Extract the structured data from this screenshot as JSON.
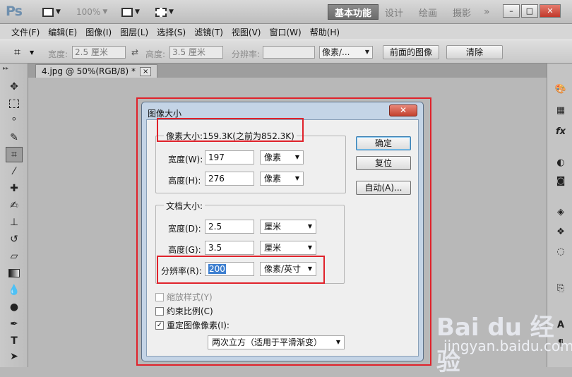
{
  "app": {
    "logo": "Ps",
    "zoom": "100%",
    "workspaces": [
      "基本功能",
      "设计",
      "绘画",
      "摄影"
    ],
    "window_controls": [
      "–",
      "□",
      "✕"
    ]
  },
  "menus": [
    "文件(F)",
    "编辑(E)",
    "图像(I)",
    "图层(L)",
    "选择(S)",
    "滤镜(T)",
    "视图(V)",
    "窗口(W)",
    "帮助(H)"
  ],
  "options": {
    "width_label": "宽度:",
    "width_value": "2.5 厘米",
    "height_label": "高度:",
    "height_value": "3.5 厘米",
    "resolution_label": "分辨率:",
    "resolution_value": "",
    "unit_value": "像素/...",
    "front_image_button": "前面的图像",
    "clear_button": "清除"
  },
  "document_tab": {
    "title": "4.jpg @ 50%(RGB/8) *",
    "close": "×"
  },
  "dialog": {
    "title": "图像大小",
    "close": "✕",
    "pixel_size_label": "像素大小:159.3K(之前为852.3K)",
    "pixel_width_label": "宽度(W):",
    "pixel_width_value": "197",
    "pixel_width_unit": "像素",
    "pixel_height_label": "高度(H):",
    "pixel_height_value": "276",
    "pixel_height_unit": "像素",
    "doc_size_label": "文档大小:",
    "doc_width_label": "宽度(D):",
    "doc_width_value": "2.5",
    "doc_width_unit": "厘米",
    "doc_height_label": "高度(G):",
    "doc_height_value": "3.5",
    "doc_height_unit": "厘米",
    "resolution_label": "分辨率(R):",
    "resolution_value": "200",
    "resolution_unit": "像素/英寸",
    "ok_button": "确定",
    "reset_button": "复位",
    "auto_button": "自动(A)...",
    "scale_styles_label": "缩放样式(Y)",
    "scale_styles_checked": false,
    "constrain_label": "约束比例(C)",
    "constrain_checked": false,
    "resample_label": "重定图像像素(I):",
    "resample_checked": true,
    "resample_method": "两次立方（适用于平滑渐变）"
  },
  "watermark": {
    "brand": "Bai du 经验",
    "url": "jingyan.baidu.com"
  },
  "colors": {
    "highlight_red": "#e0222b",
    "dialog_frame": "#c4d4e6",
    "accent_blue": "#3c7fb1"
  }
}
